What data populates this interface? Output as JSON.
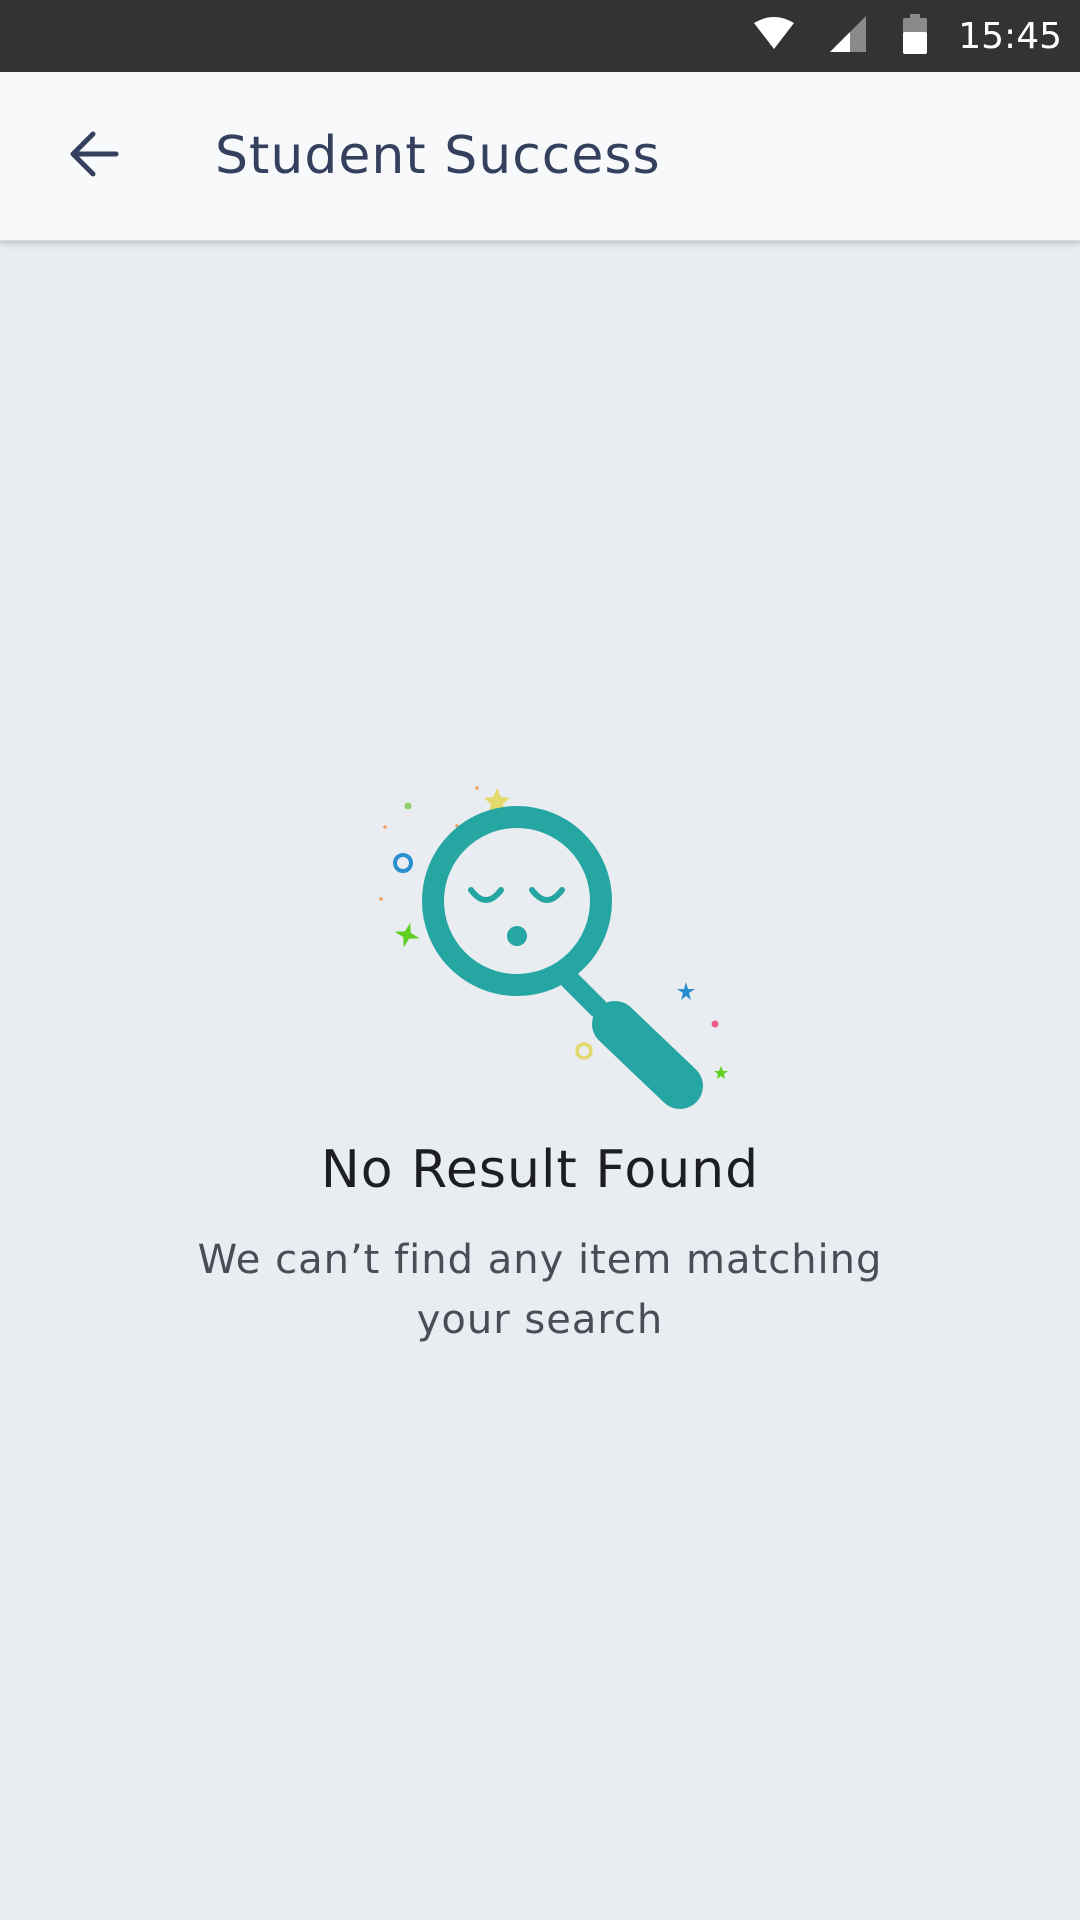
{
  "status_bar": {
    "time": "15:45",
    "icons": [
      "wifi-icon",
      "signal-icon",
      "battery-icon"
    ]
  },
  "header": {
    "back_icon": "arrow-left-icon",
    "title": "Student Success"
  },
  "empty_state": {
    "illustration": "sleepy-magnifier-icon",
    "title": "No Result Found",
    "message": "We can’t find any item matching your search"
  },
  "colors": {
    "accent": "#26a6a3",
    "header_title": "#35405e",
    "background": "#e9ecf1",
    "status_bar": "#333333"
  }
}
